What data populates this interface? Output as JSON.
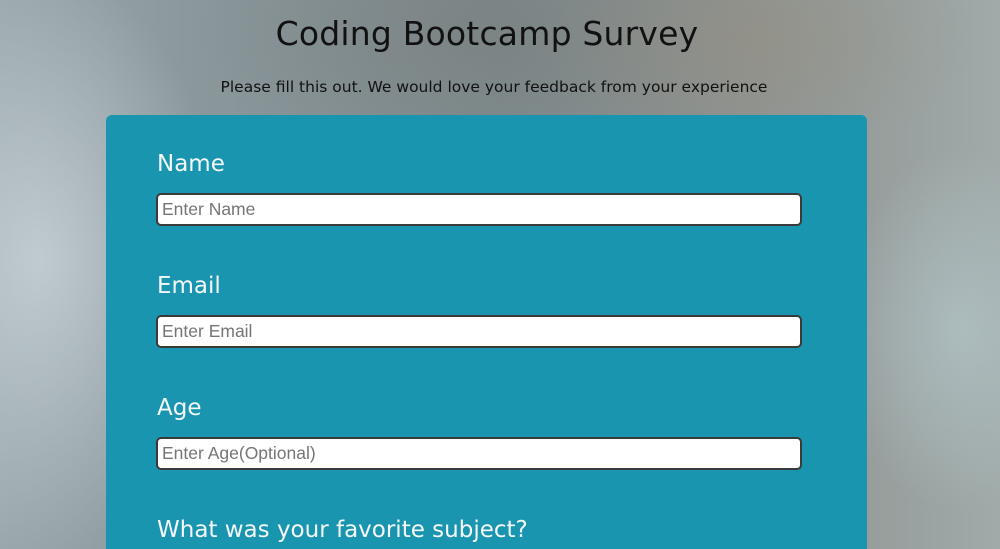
{
  "header": {
    "title": "Coding Bootcamp Survey",
    "subtitle": "Please fill this out. We would love your feedback from your experience"
  },
  "form": {
    "name": {
      "label": "Name",
      "placeholder": "Enter Name"
    },
    "email": {
      "label": "Email",
      "placeholder": "Enter Email"
    },
    "age": {
      "label": "Age",
      "placeholder": "Enter Age(Optional)"
    },
    "favorite_subject": {
      "label": "What was your favorite subject?"
    }
  },
  "colors": {
    "form_background": "#1a95b0",
    "label_text": "#f4f8fa",
    "heading_text": "#111111"
  }
}
